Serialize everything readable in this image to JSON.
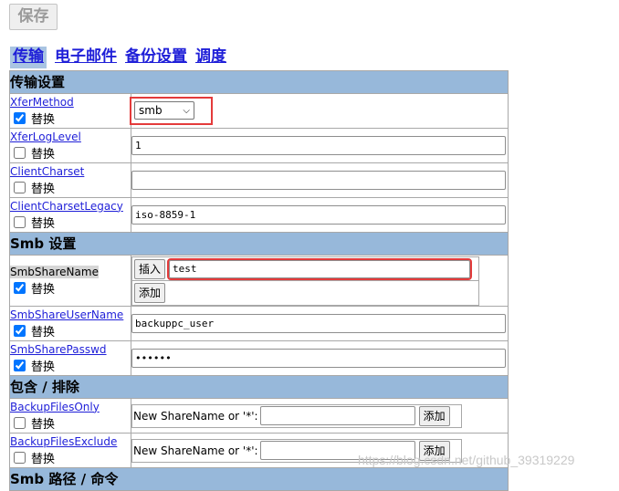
{
  "toolbar": {
    "save_label": "保存"
  },
  "tabs": [
    {
      "label": "传输",
      "active": true
    },
    {
      "label": "电子邮件",
      "active": false
    },
    {
      "label": "备份设置",
      "active": false
    },
    {
      "label": "调度",
      "active": false
    }
  ],
  "override_label": "替换",
  "sections": {
    "transfer": "传输设置",
    "smb": "Smb 设置",
    "include": "包含 / 排除",
    "smb_paths": "Smb 路径 / 命令"
  },
  "settings": {
    "XferMethod": {
      "name": "XferMethod",
      "value": "smb",
      "override": true
    },
    "XferLogLevel": {
      "name": "XferLogLevel",
      "value": "1",
      "override": false
    },
    "ClientCharset": {
      "name": "ClientCharset",
      "value": "",
      "override": false
    },
    "ClientCharsetLegacy": {
      "name": "ClientCharsetLegacy",
      "value": "iso-8859-1",
      "override": false
    },
    "SmbShareName": {
      "name": "SmbShareName",
      "insert_label": "插入",
      "add_label": "添加",
      "value": "test",
      "override": true
    },
    "SmbShareUserName": {
      "name": "SmbShareUserName",
      "value": "backuppc_user",
      "override": true
    },
    "SmbSharePasswd": {
      "name": "SmbSharePasswd",
      "value": "••••••",
      "override": true
    },
    "BackupFilesOnly": {
      "name": "BackupFilesOnly",
      "prompt": "New ShareName or '*':",
      "add_label": "添加",
      "override": false
    },
    "BackupFilesExclude": {
      "name": "BackupFilesExclude",
      "prompt": "New ShareName or '*':",
      "add_label": "添加",
      "override": false
    }
  },
  "watermark": "https://blog.csdn.net/github_39319229"
}
